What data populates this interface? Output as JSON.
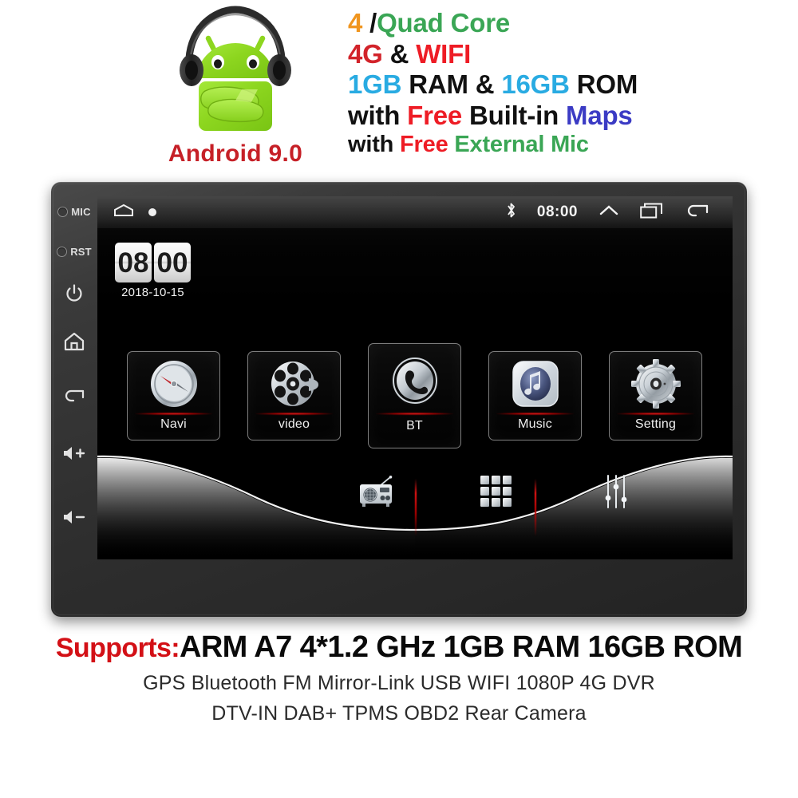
{
  "banner": {
    "android_version": "Android 9.0",
    "mascot_icon": "android-robot-with-headphones-icon",
    "spec_lines": [
      {
        "parts": [
          {
            "t": "4",
            "c": "#f0951e"
          },
          {
            "t": " /",
            "c": "#111111"
          },
          {
            "t": "Quad Core",
            "c": "#3aa655"
          }
        ]
      },
      {
        "parts": [
          {
            "t": "4G",
            "c": "#d2232a"
          },
          {
            "t": " & ",
            "c": "#111111"
          },
          {
            "t": "WIFI",
            "c": "#ee1c25"
          }
        ]
      },
      {
        "parts": [
          {
            "t": "1GB",
            "c": "#29abe2"
          },
          {
            "t": " RAM & ",
            "c": "#111111"
          },
          {
            "t": "16GB",
            "c": "#29abe2"
          },
          {
            "t": " ROM",
            "c": "#111111"
          }
        ]
      },
      {
        "parts": [
          {
            "t": "with ",
            "c": "#111111"
          },
          {
            "t": "Free",
            "c": "#ee1c25"
          },
          {
            "t": " Built-in ",
            "c": "#111111"
          },
          {
            "t": "Maps",
            "c": "#3b3bc4"
          }
        ]
      },
      {
        "parts": [
          {
            "t": "with ",
            "c": "#111111"
          },
          {
            "t": "Free",
            "c": "#ee1c25"
          },
          {
            "t": " External Mic",
            "c": "#3aa655"
          }
        ],
        "small": true
      }
    ]
  },
  "device": {
    "button_rail": [
      {
        "name": "mic-hole",
        "type": "hole",
        "label": "MIC"
      },
      {
        "name": "reset-hole",
        "type": "hole",
        "label": "RST"
      },
      {
        "name": "power-button",
        "type": "glyph",
        "glyph": "⏻"
      },
      {
        "name": "home-button",
        "type": "glyph",
        "glyph": "⌂"
      },
      {
        "name": "back-button",
        "type": "glyph",
        "glyph": "↰"
      },
      {
        "name": "volume-up-button",
        "type": "glyph",
        "glyph": "🔊+"
      },
      {
        "name": "volume-down-button",
        "type": "glyph",
        "glyph": "🔊-"
      }
    ],
    "status_bar": {
      "home_icon": "home-outline-icon",
      "dot_icon": "dot-indicator-icon",
      "bluetooth_icon": "bluetooth-icon",
      "clock": "08:00",
      "expand_icon": "chevron-up-icon",
      "recents_icon": "recent-apps-icon",
      "back_icon": "back-arrow-icon"
    },
    "clock_widget": {
      "hours": "08",
      "minutes": "00",
      "date": "2018-10-15"
    },
    "apps": [
      {
        "label": "Navi",
        "icon": "compass-icon"
      },
      {
        "label": "video",
        "icon": "film-reel-icon"
      },
      {
        "label": "BT",
        "icon": "phone-handset-icon"
      },
      {
        "label": "Music",
        "icon": "music-note-icon"
      },
      {
        "label": "Setting",
        "icon": "gear-icon"
      }
    ],
    "dock": [
      {
        "name": "radio",
        "icon": "radio-icon"
      },
      {
        "name": "all-apps",
        "icon": "app-grid-icon"
      },
      {
        "name": "equalizer",
        "icon": "equalizer-sliders-icon"
      }
    ]
  },
  "bottom": {
    "supports_word": "Supports:",
    "supports_rest": "ARM A7 4*1.2 GHz   1GB RAM   16GB ROM",
    "feature_line_1": "GPS  Bluetooth  FM  Mirror-Link  USB  WIFI  1080P  4G  DVR",
    "feature_line_2": "DTV-IN   DAB+  TPMS  OBD2  Rear Camera"
  },
  "colors": {
    "brand_red": "#d31016",
    "accent_green": "#3aa655",
    "accent_blue": "#29abe2",
    "accent_orange": "#f0951e",
    "maps_blue": "#3b3bc4",
    "screen_black": "#000000",
    "bezel": "#333333"
  }
}
